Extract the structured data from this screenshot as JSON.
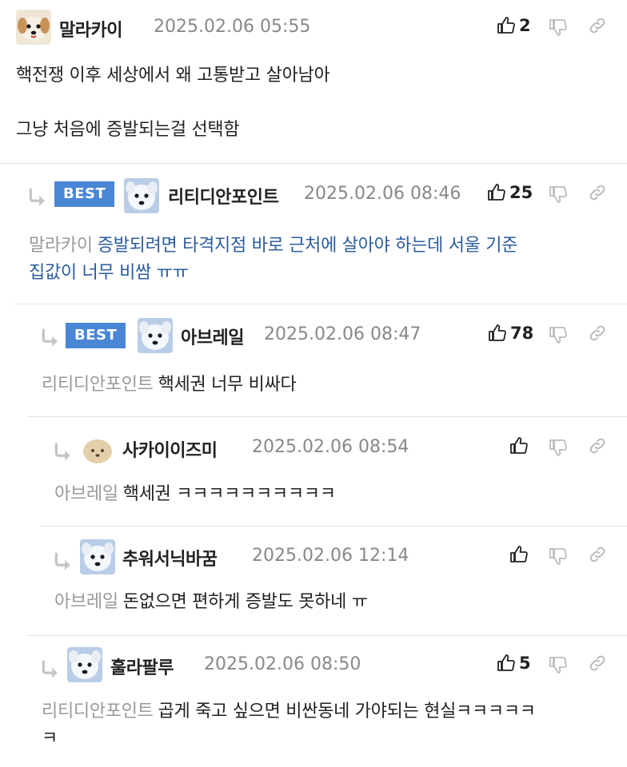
{
  "comments": [
    {
      "nick": "말라카이",
      "date": "2025.02.06 05:55",
      "likes": "2",
      "body_line1": "핵전쟁 이후 세상에서 왜 고통받고 살아남아",
      "body_line2": "그냥 처음에 증발되는걸 선택함"
    },
    {
      "best": "BEST",
      "nick": "리티디안포인트",
      "date": "2025.02.06 08:46",
      "likes": "25",
      "mention": "말라카이",
      "body_line1": "증발되려면 타격지점 바로 근처에 살아야 하는데 서울 기준",
      "body_line2": "집값이 너무 비쌈 ㅠㅠ"
    },
    {
      "best": "BEST",
      "nick": "아브레일",
      "date": "2025.02.06 08:47",
      "likes": "78",
      "mention": "리티디안포인트",
      "body_line1": "핵세권 너무 비싸다"
    },
    {
      "nick": "사카이이즈미",
      "date": "2025.02.06 08:54",
      "likes": "",
      "mention": "아브레일",
      "body_line1": "핵세권 ㅋㅋㅋㅋㅋㅋㅋㅋㅋㅋ"
    },
    {
      "nick": "추워서닉바꿈",
      "date": "2025.02.06 12:14",
      "likes": "",
      "mention": "아브레일",
      "body_line1": "돈없으면 편하게 증발도 못하네 ㅠ"
    },
    {
      "nick": "훌라팔루",
      "date": "2025.02.06 08:50",
      "likes": "5",
      "mention": "리티디안포인트",
      "body_line1": "곱게 죽고 싶으면 비싼동네 가야되는 현실ㅋㅋㅋㅋㅋ",
      "body_line2": "ㅋ"
    }
  ],
  "icons": {
    "like": "thumbs-up-icon",
    "dislike": "thumbs-down-icon",
    "share": "link-icon",
    "reply": "reply-arrow-icon"
  },
  "colors": {
    "best_badge": "#4a86d6",
    "reply_text_blue": "#2c5c9e",
    "mention_gray": "#999999"
  }
}
